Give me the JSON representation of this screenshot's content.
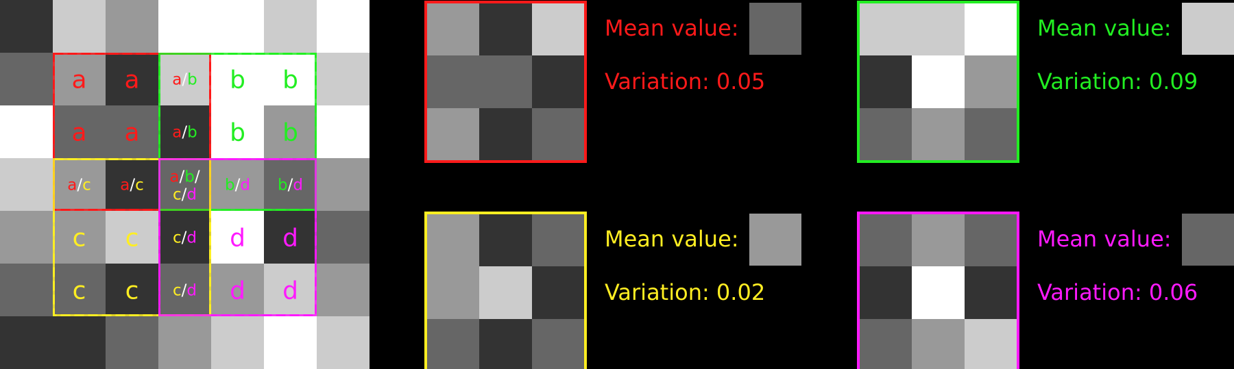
{
  "colors": {
    "a": "#ff1a1a",
    "b": "#22ee22",
    "c": "#ffee22",
    "d": "#ff1aff",
    "sep": "#ffffff",
    "background": "#000000"
  },
  "gray_levels": {
    "0": "#333333",
    "1": "#666666",
    "2": "#999999",
    "3": "#cccccc",
    "4": "#ffffff"
  },
  "image_grid": [
    [
      0,
      3,
      2,
      4,
      4,
      3,
      4
    ],
    [
      1,
      2,
      0,
      3,
      4,
      4,
      3
    ],
    [
      4,
      1,
      1,
      0,
      4,
      2,
      4
    ],
    [
      3,
      2,
      0,
      1,
      2,
      1,
      2
    ],
    [
      2,
      2,
      3,
      0,
      4,
      0,
      1
    ],
    [
      1,
      1,
      0,
      1,
      2,
      3,
      2
    ],
    [
      0,
      0,
      1,
      2,
      3,
      4,
      3
    ]
  ],
  "cell_labels": [
    {
      "row": 1,
      "col": 1,
      "parts": [
        "a"
      ]
    },
    {
      "row": 1,
      "col": 2,
      "parts": [
        "a"
      ]
    },
    {
      "row": 1,
      "col": 3,
      "parts": [
        "a",
        "b"
      ]
    },
    {
      "row": 1,
      "col": 4,
      "parts": [
        "b"
      ]
    },
    {
      "row": 1,
      "col": 5,
      "parts": [
        "b"
      ]
    },
    {
      "row": 2,
      "col": 1,
      "parts": [
        "a"
      ]
    },
    {
      "row": 2,
      "col": 2,
      "parts": [
        "a"
      ]
    },
    {
      "row": 2,
      "col": 3,
      "parts": [
        "a",
        "b"
      ]
    },
    {
      "row": 2,
      "col": 4,
      "parts": [
        "b"
      ]
    },
    {
      "row": 2,
      "col": 5,
      "parts": [
        "b"
      ]
    },
    {
      "row": 3,
      "col": 1,
      "parts": [
        "a",
        "c"
      ]
    },
    {
      "row": 3,
      "col": 2,
      "parts": [
        "a",
        "c"
      ]
    },
    {
      "row": 3,
      "col": 3,
      "parts": [
        "a",
        "b",
        "c",
        "d"
      ]
    },
    {
      "row": 3,
      "col": 4,
      "parts": [
        "b",
        "d"
      ]
    },
    {
      "row": 3,
      "col": 5,
      "parts": [
        "b",
        "d"
      ]
    },
    {
      "row": 4,
      "col": 1,
      "parts": [
        "c"
      ]
    },
    {
      "row": 4,
      "col": 2,
      "parts": [
        "c"
      ]
    },
    {
      "row": 4,
      "col": 3,
      "parts": [
        "c",
        "d"
      ]
    },
    {
      "row": 4,
      "col": 4,
      "parts": [
        "d"
      ]
    },
    {
      "row": 4,
      "col": 5,
      "parts": [
        "d"
      ]
    },
    {
      "row": 5,
      "col": 1,
      "parts": [
        "c"
      ]
    },
    {
      "row": 5,
      "col": 2,
      "parts": [
        "c"
      ]
    },
    {
      "row": 5,
      "col": 3,
      "parts": [
        "c",
        "d"
      ]
    },
    {
      "row": 5,
      "col": 4,
      "parts": [
        "d"
      ]
    },
    {
      "row": 5,
      "col": 5,
      "parts": [
        "d"
      ]
    }
  ],
  "windows": [
    {
      "id": "a",
      "color_key": "a",
      "row": 1,
      "col": 1
    },
    {
      "id": "b",
      "color_key": "b",
      "row": 1,
      "col": 3
    },
    {
      "id": "c",
      "color_key": "c",
      "row": 3,
      "col": 1
    },
    {
      "id": "d",
      "color_key": "d",
      "row": 3,
      "col": 3
    }
  ],
  "panels": [
    {
      "id": "a",
      "color_key": "a",
      "cells": [
        [
          2,
          0,
          3
        ],
        [
          1,
          1,
          0
        ],
        [
          2,
          0,
          1
        ]
      ],
      "mean_label": "Mean value:",
      "mean_level": 1,
      "variation_label": "Variation: 0.05"
    },
    {
      "id": "b",
      "color_key": "b",
      "cells": [
        [
          3,
          3,
          4
        ],
        [
          0,
          4,
          2
        ],
        [
          1,
          2,
          1
        ]
      ],
      "mean_label": "Mean value:",
      "mean_level": 3,
      "variation_label": "Variation: 0.09"
    },
    {
      "id": "c",
      "color_key": "c",
      "cells": [
        [
          2,
          0,
          1
        ],
        [
          2,
          3,
          0
        ],
        [
          1,
          0,
          1
        ]
      ],
      "mean_label": "Mean value:",
      "mean_level": 2,
      "variation_label": "Variation: 0.02"
    },
    {
      "id": "d",
      "color_key": "d",
      "cells": [
        [
          1,
          2,
          1
        ],
        [
          0,
          4,
          0
        ],
        [
          1,
          2,
          3
        ]
      ],
      "mean_label": "Mean value:",
      "mean_level": 1,
      "variation_label": "Variation: 0.06"
    }
  ]
}
